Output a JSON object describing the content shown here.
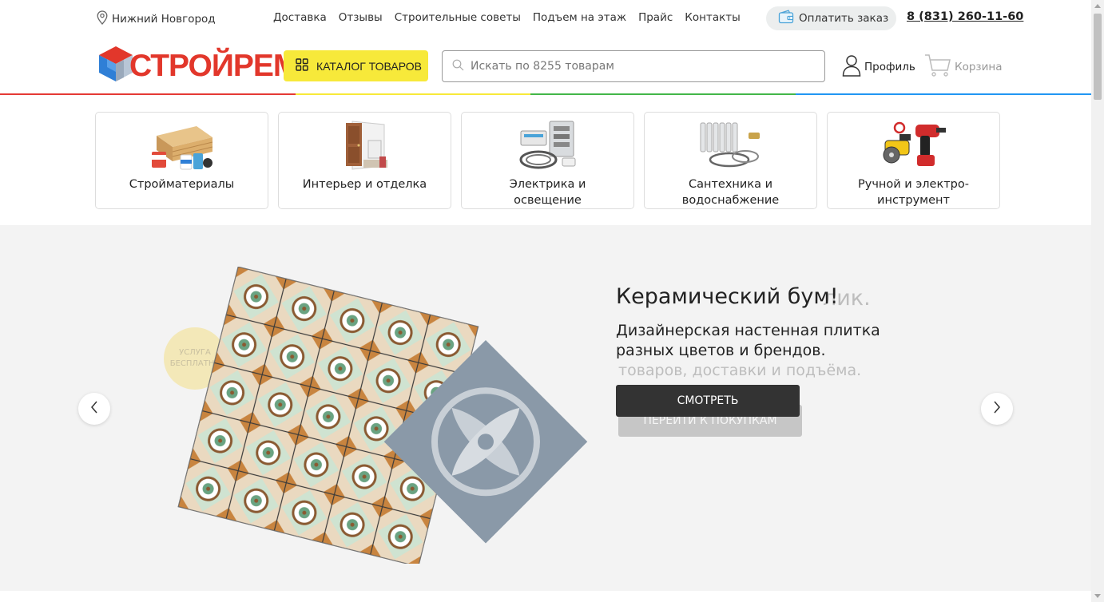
{
  "topbar": {
    "city": "Нижний Новгород",
    "nav": [
      "Доставка",
      "Отзывы",
      "Строительные советы",
      "Подъем на этаж",
      "Прайс",
      "Контакты"
    ],
    "pay_label": "Оплатить заказ",
    "phone": "8 (831) 260-11-60"
  },
  "header": {
    "logo_text": "СТРОЙРЕМ",
    "catalog_label": "КАТАЛОГ ТОВАРОВ",
    "search_placeholder": "Искать по 8255 товарам",
    "profile_label": "Профиль",
    "cart_label": "Корзина"
  },
  "colors": {
    "brand_red": "#e2372b",
    "catalog_yellow": "#f7e93a",
    "rainbow": [
      "#e53935",
      "#f7e93a",
      "#43b649",
      "#2196f3"
    ]
  },
  "categories": [
    {
      "label": "Стройматериалы",
      "icon": "lumber-icon"
    },
    {
      "label": "Интерьер и отделка",
      "icon": "door-icon"
    },
    {
      "label": "Электрика и освещение",
      "icon": "electrical-panel-icon"
    },
    {
      "label": "Сантехника и водоснабжение",
      "icon": "radiator-icon"
    },
    {
      "label": "Ручной и электро-инструмент",
      "icon": "power-tools-icon"
    }
  ],
  "banner": {
    "title": "Керамический бум!",
    "text": "Дизайнерская настенная плитка разных цветов и брендов.",
    "button": "СМОТРЕТЬ",
    "ghost_title": "лик.",
    "ghost_text": "товаров, доставки и подъёма.",
    "ghost_button": "ПЕРЕЙТИ К ПОКУПКАМ",
    "ghost_badge": "УСЛУГА БЕСПЛАТНА"
  }
}
